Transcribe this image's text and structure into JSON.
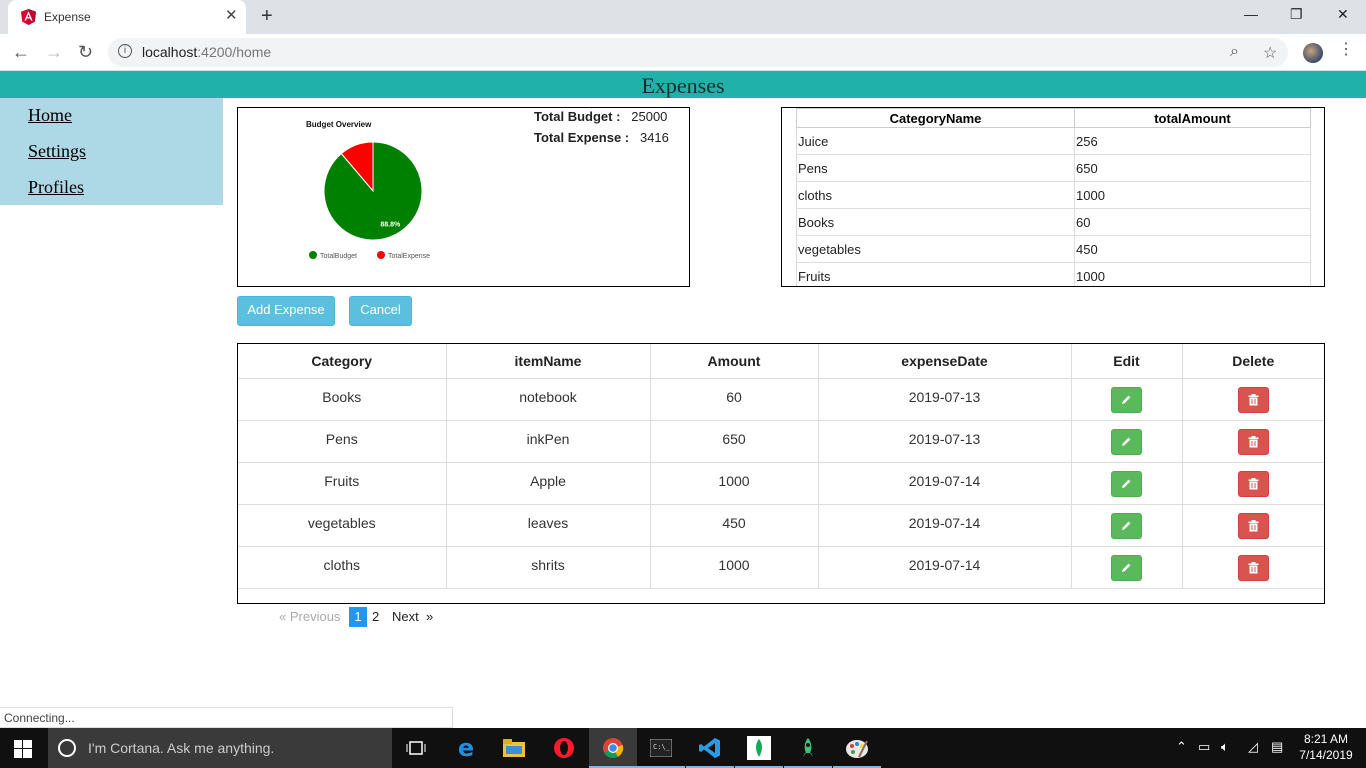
{
  "browser": {
    "tab_title": "Expense",
    "url_host": "localhost",
    "url_path": ":4200/home",
    "status_text": "Connecting..."
  },
  "app": {
    "header_title": "Expenses",
    "nav": [
      "Home",
      "Settings",
      "Profiles"
    ]
  },
  "budget": {
    "total_budget_label": "Total Budget :",
    "total_budget_value": "25000",
    "total_expense_label": "Total Expense :",
    "total_expense_value": "3416"
  },
  "chart_data": {
    "type": "pie",
    "title": "Budget Overview",
    "labels": [
      "TotalBudget",
      "TotalExpense"
    ],
    "values": [
      88.8,
      11.2
    ],
    "colors": [
      "#008000",
      "#ff0000"
    ],
    "data_labels": [
      "88.8%",
      ""
    ],
    "legend_position": "bottom"
  },
  "summary": {
    "columns": [
      "CategoryName",
      "totalAmount"
    ],
    "rows": [
      [
        "Juice",
        "256"
      ],
      [
        "Pens",
        "650"
      ],
      [
        "cloths",
        "1000"
      ],
      [
        "Books",
        "60"
      ],
      [
        "vegetables",
        "450"
      ],
      [
        "Fruits",
        "1000"
      ]
    ]
  },
  "actions": {
    "add_label": "Add Expense",
    "cancel_label": "Cancel"
  },
  "expenses": {
    "columns": [
      "Category",
      "itemName",
      "Amount",
      "expenseDate",
      "Edit",
      "Delete"
    ],
    "rows": [
      [
        "Books",
        "notebook",
        "60",
        "2019-07-13"
      ],
      [
        "Pens",
        "inkPen",
        "650",
        "2019-07-13"
      ],
      [
        "Fruits",
        "Apple",
        "1000",
        "2019-07-14"
      ],
      [
        "vegetables",
        "leaves",
        "450",
        "2019-07-14"
      ],
      [
        "cloths",
        "shrits",
        "1000",
        "2019-07-14"
      ]
    ]
  },
  "pagination": {
    "prev": "« Previous",
    "pages": [
      "1",
      "2"
    ],
    "current": "1",
    "next": "Next"
  },
  "taskbar": {
    "search_placeholder": "I'm Cortana. Ask me anything.",
    "time": "8:21 AM",
    "date": "7/14/2019"
  },
  "colors": {
    "header": "#20b2aa",
    "sidebar": "#add8e6",
    "button": "#5bc0de",
    "edit": "#5cb85c",
    "delete": "#d9534f",
    "active_page": "#2196f3"
  }
}
